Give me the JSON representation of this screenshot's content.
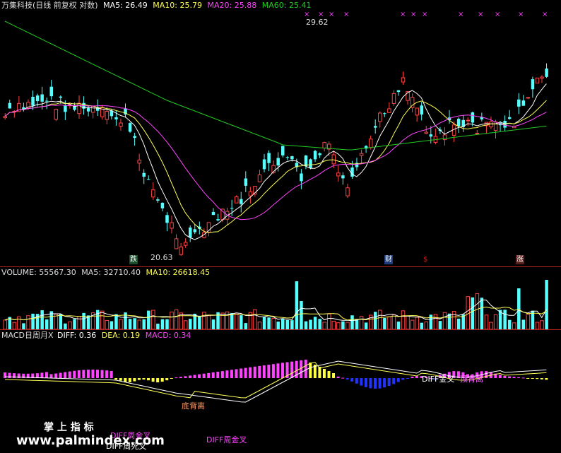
{
  "price": {
    "stock_name": "万集科技(日线 前复权 对数)",
    "ma5": "MA5: 26.49",
    "ma10": "MA10: 25.79",
    "ma20": "MA20: 25.88",
    "ma60": "MA60: 25.41",
    "high_label": "29.62",
    "low_label": "20.63",
    "events": [
      {
        "text": "跌",
        "color": "#22aa44"
      },
      {
        "text": "财",
        "color": "#3366dd"
      },
      {
        "text": "$",
        "color": "#cc2222"
      },
      {
        "text": "涨",
        "color": "#cc2222"
      }
    ],
    "colors": {
      "ma5": "#ffffff",
      "ma10": "#ffff55",
      "ma20": "#ff44ff",
      "ma60": "#22cc22",
      "up": "#ff4444",
      "down": "#55ffff"
    }
  },
  "volume": {
    "volume": "VOLUME: 55567.30",
    "ma5": "MA5: 32710.40",
    "ma10": "MA10: 26618.45"
  },
  "macd": {
    "title": "MACD日周月X",
    "diff": "DIFF: 0.36",
    "dea": "DEA: 0.19",
    "macd": "MACD: 0.34",
    "notes": {
      "diff_cross": "DIFF金叉",
      "bottom_div": "底背离",
      "top_div": "顶背离",
      "week_cross_1": "DIFF周金叉",
      "week_cross_2": "DIFF周金叉",
      "dead_cross": "DIFF周死叉"
    }
  },
  "watermark": {
    "title": "掌 上 指 标",
    "url": "www.palmindex.com"
  }
}
